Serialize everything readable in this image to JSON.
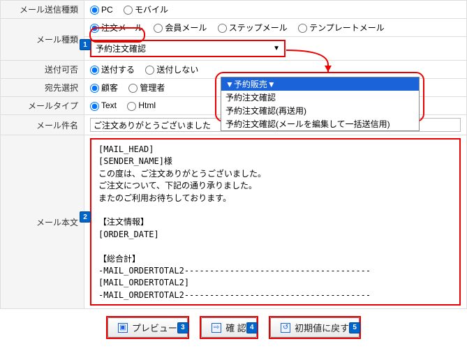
{
  "rows": {
    "sendType": {
      "label": "メール送信種類",
      "opt1": "PC",
      "opt2": "モバイル"
    },
    "mailKind": {
      "label": "メール種類",
      "opt1": "注文メール",
      "opt2": "会員メール",
      "opt3": "ステップメール",
      "opt4": "テンプレートメール"
    },
    "dropdown": {
      "value": "予約注文確認"
    },
    "sendable": {
      "label": "送付可否",
      "opt1": "送付する",
      "opt2": "送付しない"
    },
    "dest": {
      "label": "宛先選択",
      "opt1": "顧客",
      "opt2": "管理者"
    },
    "mailtype": {
      "label": "メールタイプ",
      "opt1": "Text",
      "opt2": "Html"
    },
    "subject": {
      "label": "メール件名",
      "value": "ご注文ありがとうございました"
    },
    "body": {
      "label": "メール本文"
    }
  },
  "menu": {
    "item1": "▼予約販売▼",
    "item2": "予約注文確認",
    "item3": "予約注文確認(再送用)",
    "item4": "予約注文確認(メールを編集して一括送信用)"
  },
  "bodyText": "[MAIL_HEAD]\n[SENDER_NAME]様\nこの度は、ご注文ありがとうございました。\nご注文について、下記の通り承りました。\nまたのご利用お待ちしております。\n\n【注文情報】\n[ORDER_DATE]\n\n【総合計】\n-MAIL_ORDERTOTAL2-------------------------------------\n[MAIL_ORDERTOTAL2]\n-MAIL_ORDERTOTAL2-------------------------------------\n\n\n【注文者情報】\n■ 名 前 ：[SENDER_NAME]",
  "buttons": {
    "preview": "プレビュー",
    "confirm": "確 認",
    "reset": "初期値に戻す"
  },
  "badges": {
    "b1": "1",
    "b2": "2",
    "b3": "3",
    "b4": "4",
    "b5": "5"
  }
}
